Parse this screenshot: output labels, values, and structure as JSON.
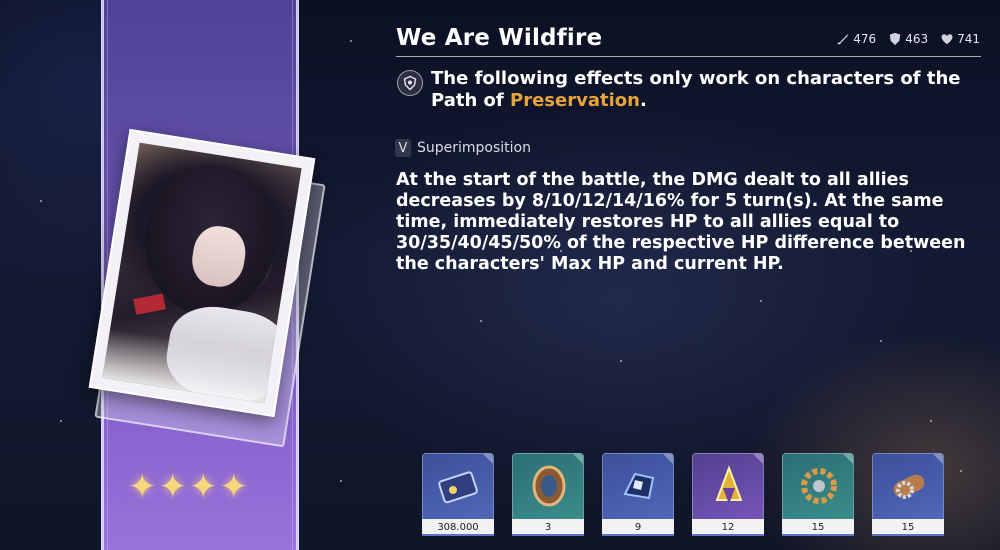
{
  "light_cone": {
    "name": "We Are Wildfire",
    "rarity_stars": 4,
    "stats": [
      {
        "icon": "attack-icon",
        "value": "476"
      },
      {
        "icon": "defense-icon",
        "value": "463"
      },
      {
        "icon": "hp-icon",
        "value": "741"
      }
    ],
    "path_text_before": "The following effects only work on characters of the Path of ",
    "path_name": "Preservation",
    "path_text_after": ".",
    "superimposition_level": "V",
    "superimposition_label": "Superimposition",
    "description": "At the start of the battle, the DMG dealt to all allies decreases by 8/10/12/14/16% for 5 turn(s). At the same time, immediately restores HP to all allies equal to 30/35/40/45/50% of the respective HP difference between the characters' Max HP and current HP."
  },
  "colors": {
    "accent_orange": "#e8a23c",
    "banner_purple": "#7a5ec4",
    "star_gold": "#f6d77c"
  },
  "materials": [
    {
      "icon": "credit-card-icon",
      "count": "308.000",
      "rarity": "blue"
    },
    {
      "icon": "shield-material-icon",
      "count": "3",
      "rarity": "teal"
    },
    {
      "icon": "crystal-gauntlet-icon",
      "count": "9",
      "rarity": "blue"
    },
    {
      "icon": "golden-relic-icon",
      "count": "12",
      "rarity": "purple"
    },
    {
      "icon": "gear-wheel-icon",
      "count": "15",
      "rarity": "teal"
    },
    {
      "icon": "gear-scroll-icon",
      "count": "15",
      "rarity": "blue"
    }
  ]
}
